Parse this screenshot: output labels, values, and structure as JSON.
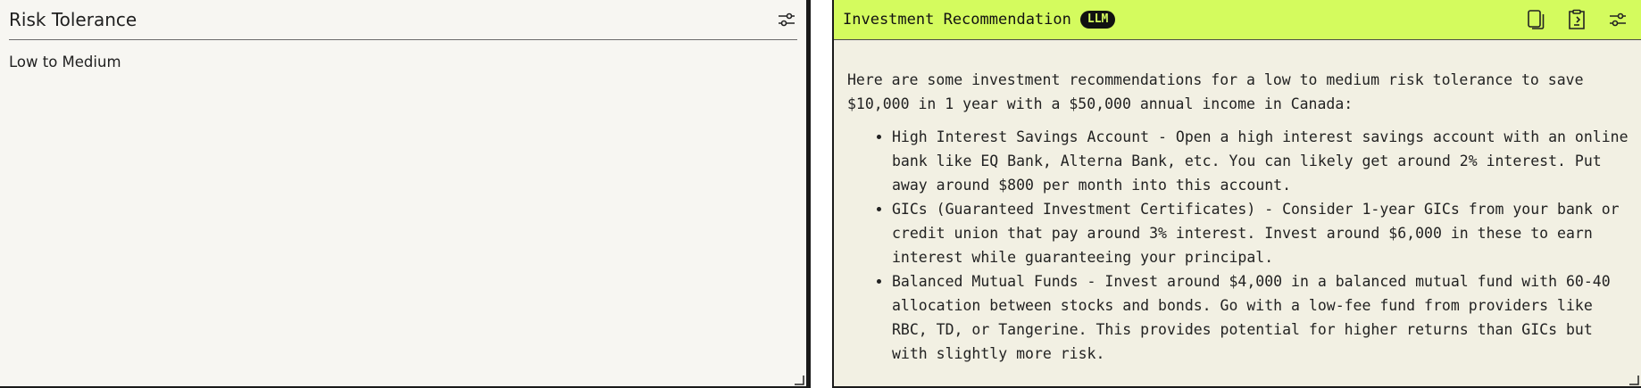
{
  "left_panel": {
    "title": "Risk Tolerance",
    "value": "Low to Medium",
    "icons": [
      "sliders-icon",
      "resize-icon"
    ]
  },
  "right_panel": {
    "title": "Investment Recommendation",
    "badge": "LLM",
    "header_color": "#d4fb5e",
    "icons": [
      "copy-icon",
      "clipboard-icon",
      "sliders-icon",
      "resize-icon"
    ],
    "intro": "Here are some investment recommendations for a low to medium risk tolerance to save $10,000 in 1 year with a $50,000 annual income in Canada:",
    "bullets": [
      "High Interest Savings Account - Open a high interest savings account with an online bank like EQ Bank, Alterna Bank, etc. You can likely get around 2% interest. Put away around $800 per month into this account.",
      "GICs (Guaranteed Investment Certificates) - Consider 1-year GICs from your bank or credit union that pay around 3% interest. Invest around $6,000 in these to earn interest while guaranteeing your principal.",
      "Balanced Mutual Funds - Invest around $4,000 in a balanced mutual fund with 60-40 allocation between stocks and bonds. Go with a low-fee fund from providers like RBC, TD, or Tangerine. This provides potential for higher returns than GICs but with slightly more risk."
    ]
  }
}
